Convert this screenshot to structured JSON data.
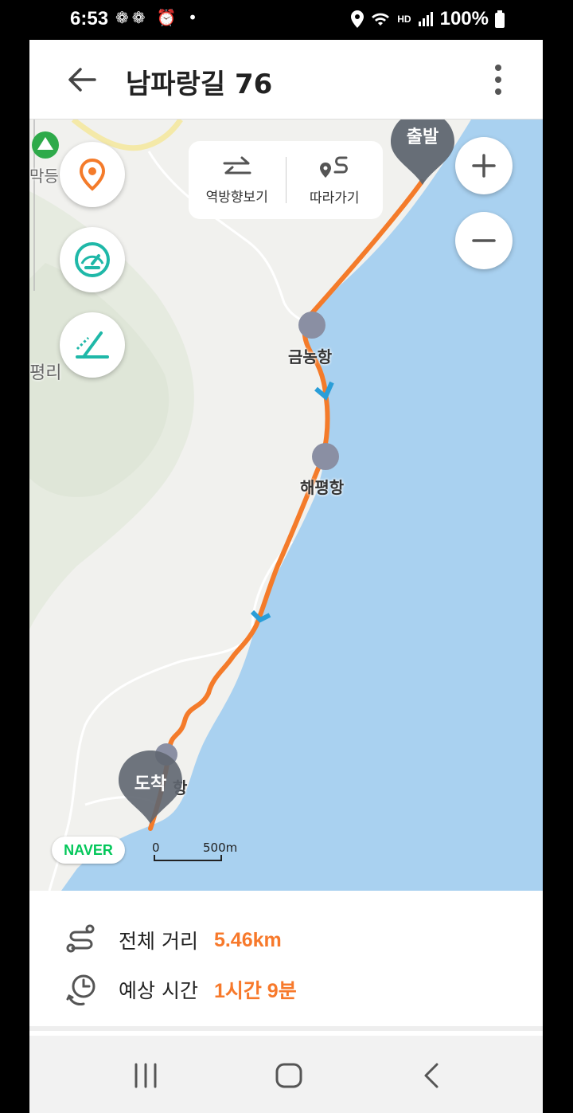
{
  "status_bar": {
    "time": "6:53",
    "left_icons": "❁❁ ⏰ •",
    "hd_voice": "HD",
    "battery": "100%"
  },
  "header": {
    "title": "남파랑길 76"
  },
  "map": {
    "tools": {
      "reverse_label": "역방향보기",
      "follow_label": "따라가기"
    },
    "labels": {
      "left_top": "막등",
      "left_mid": "평리",
      "port1": "금농항",
      "port2": "해평항",
      "port3": "항"
    },
    "pins": {
      "start": "출발",
      "end": "도착"
    },
    "logo": "NAVER",
    "scale_zero": "0",
    "scale_distance": "500m",
    "colors": {
      "route": "#f47b2a",
      "sea": "#a9d1f0",
      "land": "#f1f1ee",
      "pin": "#5f6670"
    }
  },
  "summary": {
    "distance_label": "전체 거리",
    "distance_value": "5.46km",
    "time_label": "예상 시간",
    "time_value": "1시간 9분"
  }
}
